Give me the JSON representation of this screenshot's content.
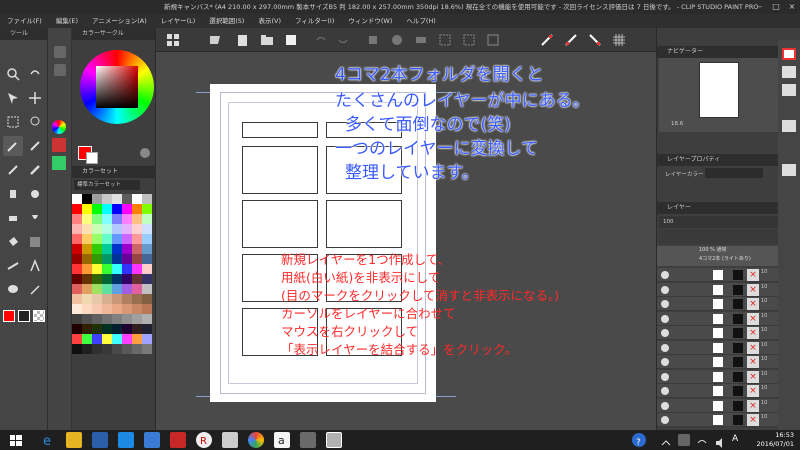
{
  "window": {
    "title": "新規キャンバス* (A4 210.00 x 297.00mm 製本サイズB5 判 182.00 x 257.00mm 350dpi 18.6%)  現在全ての機能を使用可能です - 次回ライセンス評価日は 7 日後です。 - CLIP STUDIO PAINT PRO"
  },
  "menu": {
    "items": [
      "ファイル(F)",
      "編集(E)",
      "アニメーション(A)",
      "レイヤー(L)",
      "選択範囲(S)",
      "表示(V)",
      "フィルター(I)",
      "ウィンドウ(W)",
      "ヘルプ(H)"
    ]
  },
  "panels": {
    "tool": "ツール",
    "color_circle": "カラーサークル",
    "color_set": "カラーセット",
    "color_set_name": "標準カラーセット",
    "navigator": "ナビゲーター",
    "layer_property": "レイヤープロパティ",
    "layer_property_label": "レイヤーカラー",
    "layer": "レイヤー",
    "layer_percent": "100",
    "folder_blend": "100 % 通常",
    "folder_name": "4コマ2本 (ライトあり)",
    "layer_row_value": "10"
  },
  "annotation": {
    "blue_lines": [
      "4コマ2本フォルダを開くと",
      "たくさんのレイヤーが中にある。",
      "多くて面倒なので(笑)",
      "一つのレイヤーに変換して",
      "整理しています。"
    ],
    "red_lines": [
      "新規レイヤーを1つ作成して、",
      "用紙(白い紙)を非表示にして",
      "(目のマークをクリックして消すと非表示になる。)",
      "カーソルをレイヤーに合わせて",
      "マウスを右クリックして",
      "「表示レイヤーを結合する」をクリック。"
    ]
  },
  "canvas": {
    "zoom": "18.6"
  },
  "taskbar": {
    "time": "16:53",
    "date": "2016/07/01",
    "ime": "A"
  },
  "colors": {
    "annotation_blue": "#3a5bff",
    "annotation_red": "#ff2a2a",
    "background": "#3c3c3c",
    "panel": "#3e3e3e"
  }
}
